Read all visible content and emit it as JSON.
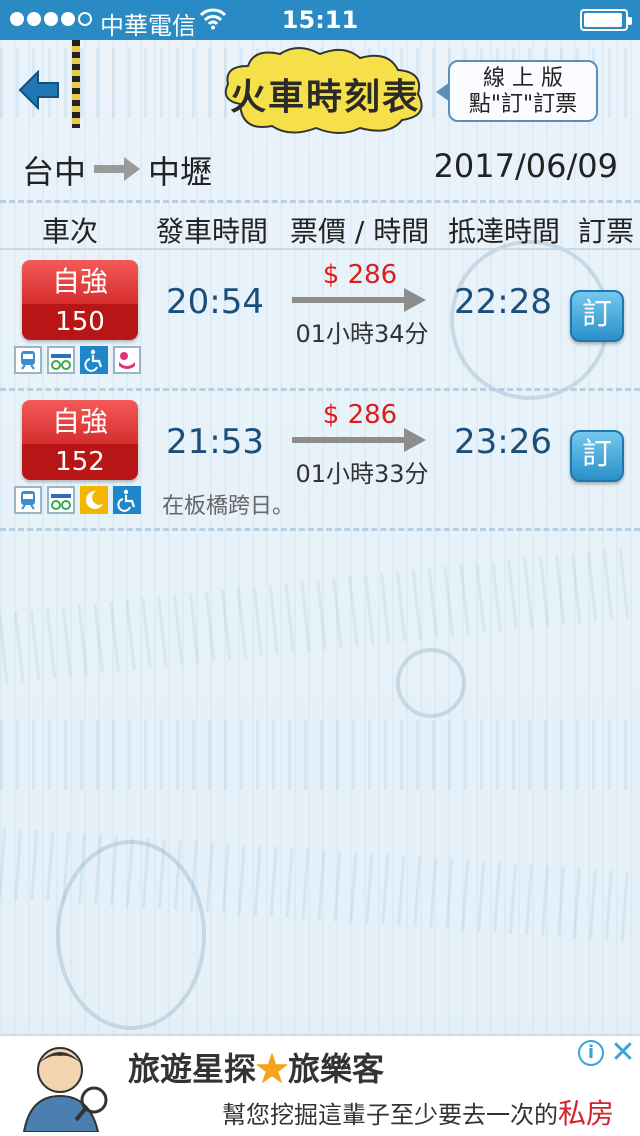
{
  "status_bar": {
    "carrier": "中華電信",
    "time": "15:11"
  },
  "header": {
    "title": "火車時刻表",
    "online_box_line1": "線 上 版",
    "online_box_line2": "點\"訂\"訂票"
  },
  "route": {
    "from": "台中",
    "to": "中壢",
    "date": "2017/06/09"
  },
  "columns": {
    "train": "車次",
    "depart": "發車時間",
    "price_time": "票價 / 時間",
    "arrive": "抵達時間",
    "book": "訂票"
  },
  "trains": [
    {
      "type": "自強",
      "number": "150",
      "depart": "20:54",
      "price": "$ 286",
      "duration": "01小時34分",
      "arrive": "22:28",
      "book_label": "訂",
      "note": ""
    },
    {
      "type": "自強",
      "number": "152",
      "depart": "21:53",
      "price": "$ 286",
      "duration": "01小時33分",
      "arrive": "23:26",
      "book_label": "訂",
      "note": "在板橋跨日。"
    }
  ],
  "ad": {
    "title_part1": "旅遊星探",
    "title_part2": "旅樂客",
    "subtitle": "幫您挖掘這輩子至少要去一次的",
    "highlight": "私房秘境",
    "info": "i",
    "close": "✕"
  },
  "colors": {
    "status_bar": "#2a8ac3",
    "train_badge": "#d62d2d",
    "time_text": "#1b4f7a",
    "price_text": "#e01b1b",
    "book_button": "#2a90c9"
  },
  "icons": [
    "back-arrow-icon",
    "train-icon",
    "bike-icon",
    "wheelchair-icon",
    "baby-icon",
    "moon-icon"
  ]
}
